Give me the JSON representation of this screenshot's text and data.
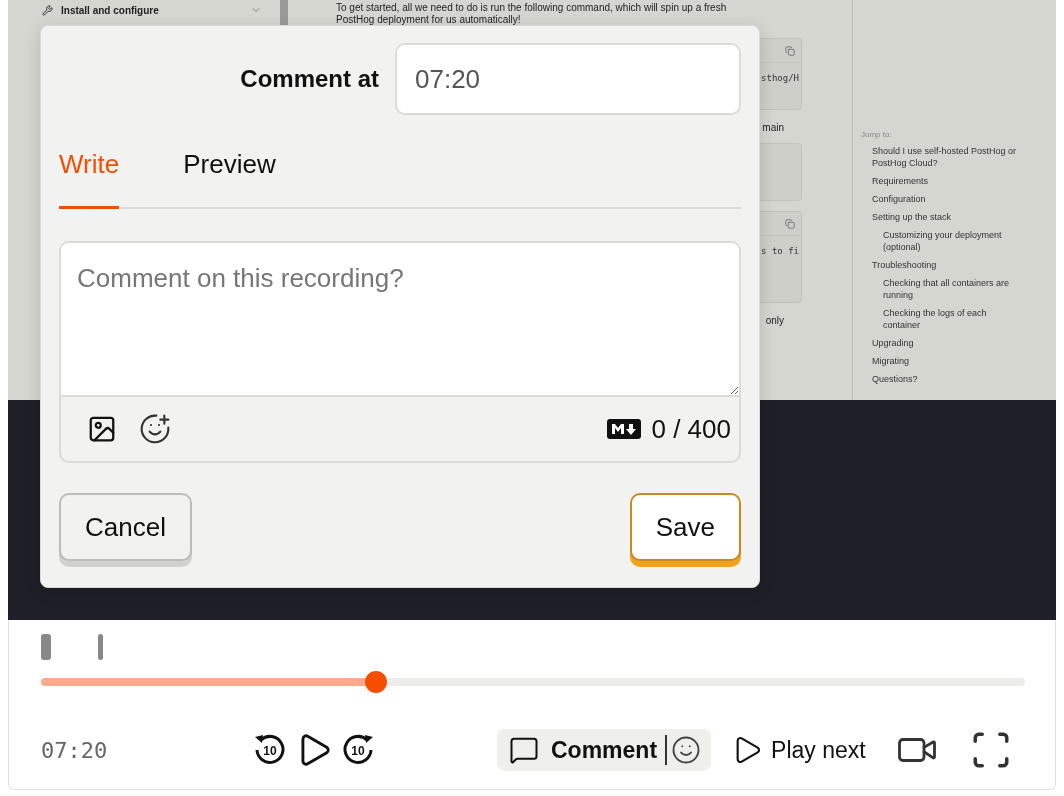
{
  "docs": {
    "sidebar": {
      "items": [
        {
          "label": "Install and configure",
          "expanded": false
        }
      ]
    },
    "content": {
      "intro_line_1": "To get started, all we need to do is run the following command, which will spin up a fresh",
      "intro_line_2": "PostHog deployment for us automatically!",
      "blocks": [
        {
          "kind": "code",
          "copy": true,
          "text": "sthog/H"
        },
        {
          "kind": "text",
          "text": "main"
        },
        {
          "kind": "code",
          "copy": false
        },
        {
          "kind": "code",
          "copy": true,
          "text": "s to fi"
        },
        {
          "kind": "text",
          "text": "only"
        }
      ]
    },
    "toc": {
      "title": "Jump to:",
      "items": [
        {
          "label": "Should I use self-hosted PostHog or PostHog Cloud?"
        },
        {
          "label": "Requirements"
        },
        {
          "label": "Configuration"
        },
        {
          "label": "Setting up the stack",
          "children": [
            {
              "label": "Customizing your deployment (optional)"
            }
          ]
        },
        {
          "label": "Troubleshooting",
          "children": [
            {
              "label": "Checking that all containers are running"
            },
            {
              "label": "Checking the logs of each container"
            }
          ]
        },
        {
          "label": "Upgrading"
        },
        {
          "label": "Migrating"
        },
        {
          "label": "Questions?"
        }
      ]
    }
  },
  "comment_dialog": {
    "label": "Comment at",
    "time": "07:20",
    "tabs": [
      {
        "label": "Write",
        "selected": true
      },
      {
        "label": "Preview",
        "selected": false
      }
    ],
    "placeholder": "Comment on this recording?",
    "counter": "0 / 400",
    "cancel": "Cancel",
    "save": "Save"
  },
  "player": {
    "progress": {
      "level": 0.34
    },
    "time": "07:20",
    "skip_back": "10",
    "skip_forward": "10",
    "comment": "Comment",
    "play_next": "Play next"
  }
}
